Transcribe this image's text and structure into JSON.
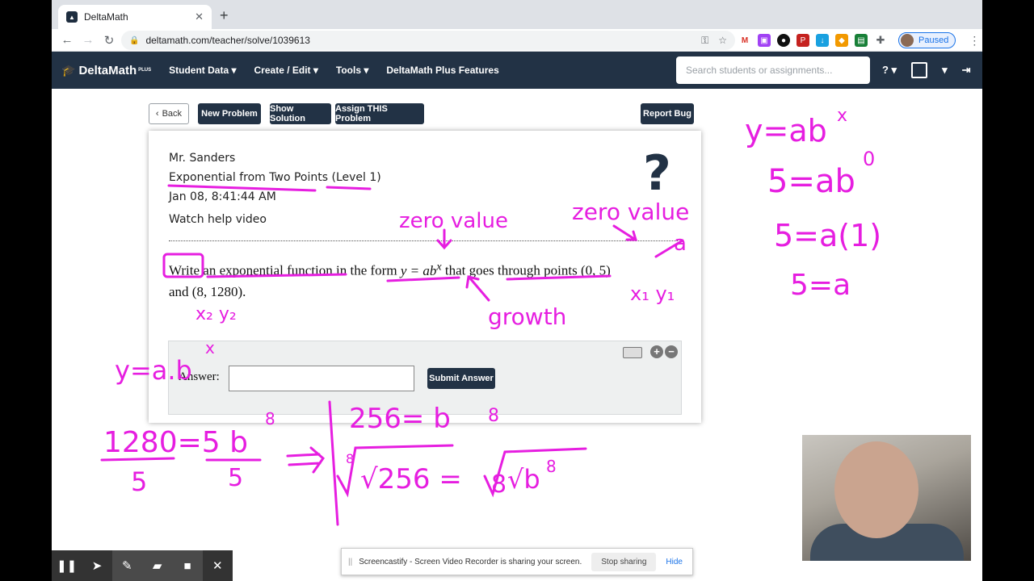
{
  "browser": {
    "tab_title": "DeltaMath",
    "url": "deltamath.com/teacher/solve/1039613",
    "profile_status": "Paused"
  },
  "nav": {
    "brand": "DeltaMath",
    "brand_sup": "PLUS",
    "menus": [
      "Student Data ▾",
      "Create / Edit ▾",
      "Tools ▾",
      "DeltaMath Plus Features"
    ],
    "search_placeholder": "Search students or assignments...",
    "help": "? ▾"
  },
  "toolbar": {
    "back": "Back",
    "new_problem": "New Problem",
    "show_solution": "Show Solution",
    "assign": "Assign THIS Problem",
    "report_bug": "Report Bug"
  },
  "problem": {
    "teacher": "Mr. Sanders",
    "topic": "Exponential from Two Points (Level 1)",
    "date": "Jan 08, 8:41:44 AM",
    "help_video": "Watch help video",
    "question_pre": "Write an exponential function in the form",
    "formula": "y = ab",
    "formula_exp": "x",
    "question_mid": "that goes through points",
    "point1": "(0, 5)",
    "question_and": "and",
    "point2": "(8, 1280)."
  },
  "answer": {
    "label": "Answer:",
    "submit": "Submit Answer"
  },
  "screencast": {
    "message": "Screencastify - Screen Video Recorder is sharing your screen.",
    "stop": "Stop sharing",
    "hide": "Hide"
  },
  "handwriting": {
    "right_column": [
      "y=ab",
      "x",
      "5=ab",
      "0",
      "5=a(1)",
      "5=a"
    ],
    "labels": [
      "zero value",
      "zero value",
      "growth",
      "x₂ y₂",
      "x₁ y₁",
      "a",
      "y=a.b",
      "x"
    ],
    "work": [
      "1280=5 b",
      "8",
      "5",
      "5",
      "=>",
      "256= b",
      "8",
      "8",
      "√256 = ",
      "8",
      "√b",
      "8"
    ]
  },
  "colors": {
    "ink": "#e61ee0",
    "navy": "#223245"
  }
}
